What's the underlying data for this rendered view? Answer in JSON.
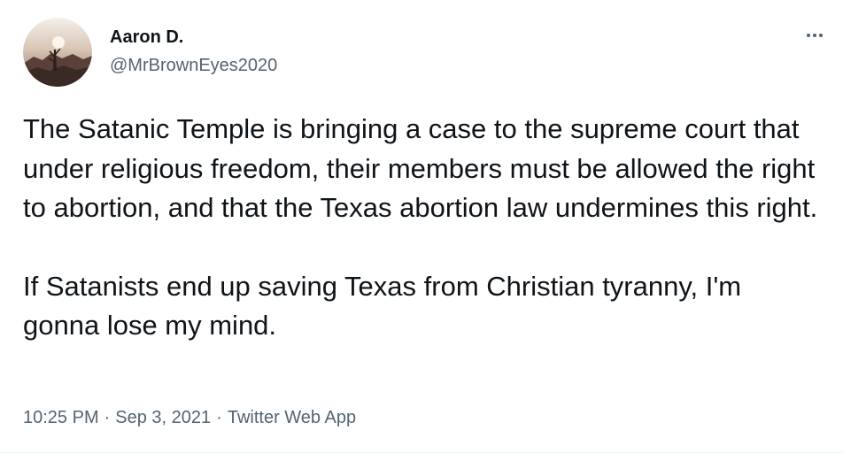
{
  "author": {
    "name": "Aaron D.",
    "handle": "@MrBrownEyes2020",
    "avatar_icon": "profile-photo-desert-sunset"
  },
  "menu": {
    "more_icon": "more-horizontal-icon"
  },
  "tweet": {
    "paragraphs": [
      "The Satanic Temple is bringing a case to the supreme court that under religious freedom, their members must be allowed the right to abortion, and that the Texas abortion law undermines this right.",
      "If Satanists end up saving Texas from Christian tyranny, I'm gonna lose my mind."
    ],
    "time": "10:25 PM",
    "date": "Sep 3, 2021",
    "source": "Twitter Web App",
    "separator": "·"
  },
  "colors": {
    "primary_text": "#0f1419",
    "secondary_text": "#536471",
    "background": "#ffffff"
  }
}
